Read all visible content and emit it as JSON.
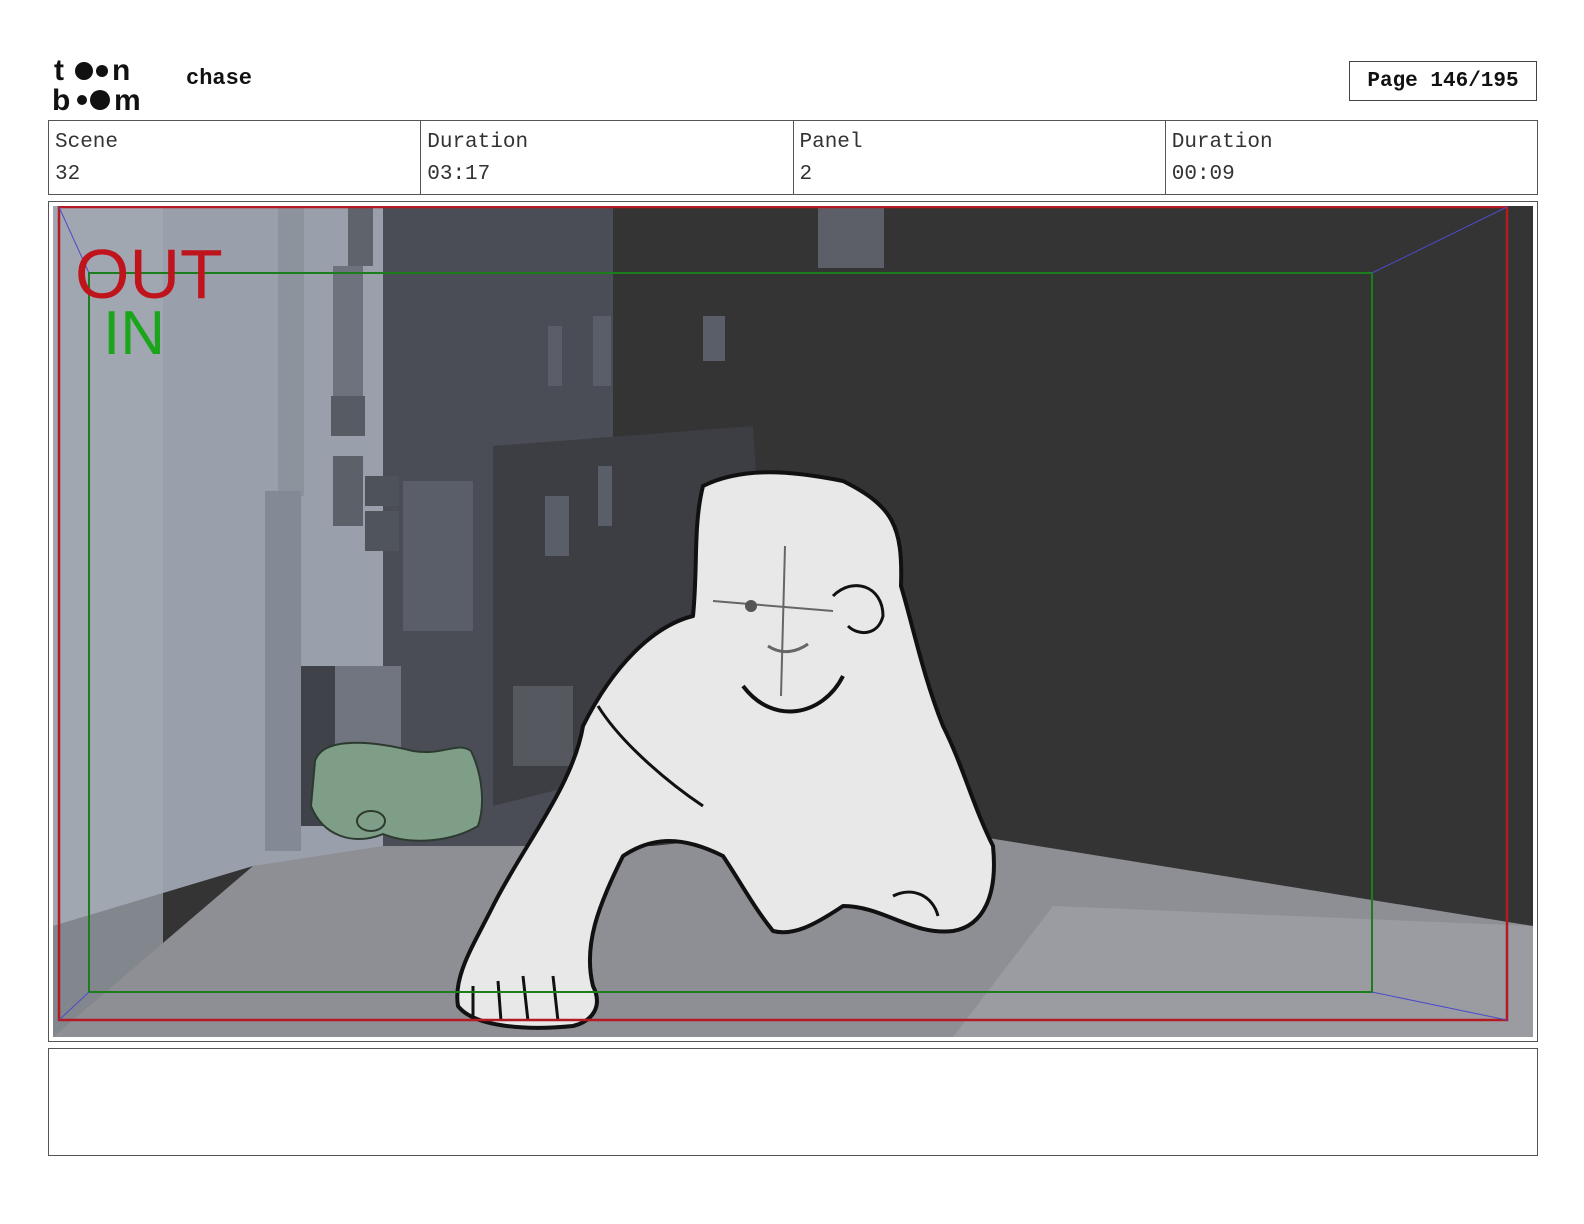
{
  "header": {
    "logo_text": "toon boom",
    "project_title": "chase",
    "page_label": "Page 146/195"
  },
  "info": [
    {
      "label": "Scene",
      "value": "32"
    },
    {
      "label": "Duration",
      "value": "03:17"
    },
    {
      "label": "Panel",
      "value": "2"
    },
    {
      "label": "Duration",
      "value": "00:09"
    }
  ],
  "panel": {
    "out_label": "OUT",
    "in_label": "IN",
    "colors": {
      "out": "#c0141c",
      "in": "#1aa51a",
      "wall_dark": "#343434",
      "floor": "#8e8f94",
      "left_wall": "#9aa0ab",
      "sketch_fill": "#e8e8e8",
      "toy_green": "#7f9e88"
    }
  },
  "notes": {
    "text": ""
  }
}
